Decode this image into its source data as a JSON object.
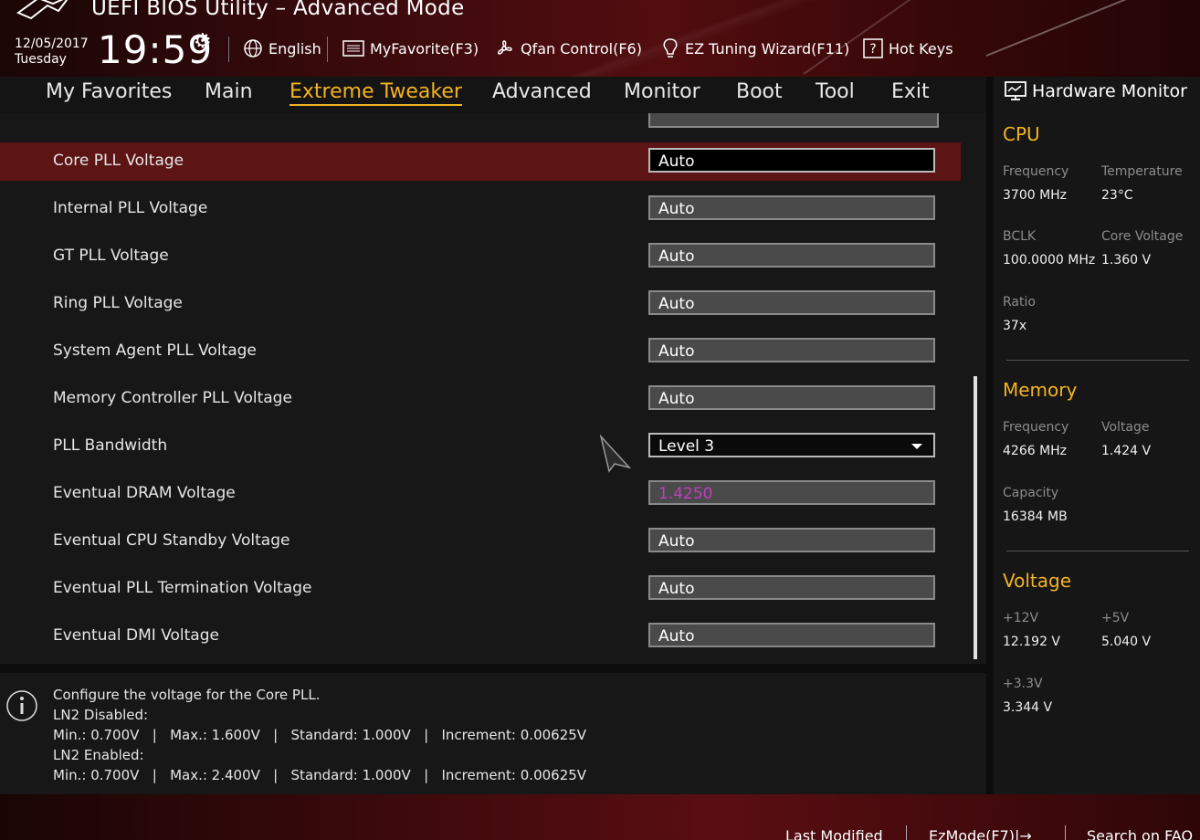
{
  "header": {
    "title": "UEFI BIOS Utility – Advanced Mode",
    "date": "12/05/2017",
    "day": "Tuesday",
    "time": "19:59",
    "buttons": {
      "language": "English",
      "favorite": "MyFavorite(F3)",
      "qfan": "Qfan Control(F6)",
      "ez_tuning": "EZ Tuning Wizard(F11)",
      "hotkeys": "Hot Keys"
    }
  },
  "tabs": [
    "My Favorites",
    "Main",
    "Extreme Tweaker",
    "Advanced",
    "Monitor",
    "Boot",
    "Tool",
    "Exit"
  ],
  "settings": [
    {
      "label": "Core PLL Voltage",
      "value": "Auto"
    },
    {
      "label": "Internal PLL Voltage",
      "value": "Auto"
    },
    {
      "label": "GT PLL Voltage",
      "value": "Auto"
    },
    {
      "label": "Ring PLL Voltage",
      "value": "Auto"
    },
    {
      "label": "System Agent PLL Voltage",
      "value": "Auto"
    },
    {
      "label": "Memory Controller PLL Voltage",
      "value": "Auto"
    },
    {
      "label": "PLL Bandwidth",
      "value": "Level 3"
    },
    {
      "label": "Eventual DRAM Voltage",
      "value": "1.4250"
    },
    {
      "label": "Eventual CPU Standby Voltage",
      "value": "Auto"
    },
    {
      "label": "Eventual PLL Termination Voltage",
      "value": "Auto"
    },
    {
      "label": "Eventual DMI Voltage",
      "value": "Auto"
    }
  ],
  "help": {
    "lines": [
      "Configure the voltage for the Core PLL.",
      "LN2 Disabled:",
      "Min.: 0.700V   |   Max.: 1.600V   |   Standard: 1.000V   |   Increment: 0.00625V",
      "LN2 Enabled:",
      "Min.: 0.700V   |   Max.: 2.400V   |   Standard: 1.000V   |   Increment: 0.00625V"
    ]
  },
  "monitor": {
    "title": "Hardware Monitor",
    "cpu": {
      "heading": "CPU",
      "frequency_label": "Frequency",
      "frequency": "3700 MHz",
      "temperature_label": "Temperature",
      "temperature": "23°C",
      "bclk_label": "BCLK",
      "bclk": "100.0000 MHz",
      "core_voltage_label": "Core Voltage",
      "core_voltage": "1.360 V",
      "ratio_label": "Ratio",
      "ratio": "37x"
    },
    "memory": {
      "heading": "Memory",
      "frequency_label": "Frequency",
      "frequency": "4266 MHz",
      "voltage_label": "Voltage",
      "voltage": "1.424 V",
      "capacity_label": "Capacity",
      "capacity": "16384 MB"
    },
    "voltage": {
      "heading": "Voltage",
      "v12_label": "+12V",
      "v12": "12.192 V",
      "v5_label": "+5V",
      "v5": "5.040 V",
      "v33_label": "+3.3V",
      "v33": "3.344 V"
    }
  },
  "footer": {
    "last_modified": "Last Modified",
    "ezmode": "EzMode(F7)|→",
    "search": "Search on FAQ"
  },
  "colors": {
    "accent": "#f4b321",
    "selected_row": "#5c1414",
    "dram_value": "#c040c0"
  }
}
